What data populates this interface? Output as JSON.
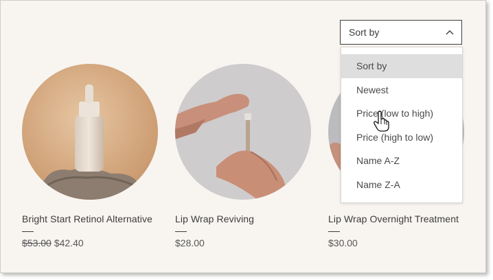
{
  "sort": {
    "label": "Sort by",
    "options": [
      {
        "label": "Sort by",
        "selected": true
      },
      {
        "label": "Newest",
        "selected": false
      },
      {
        "label": "Price (low to high)",
        "selected": false
      },
      {
        "label": "Price (high to low)",
        "selected": false
      },
      {
        "label": "Name A-Z",
        "selected": false
      },
      {
        "label": "Name Z-A",
        "selected": false
      }
    ]
  },
  "products": [
    {
      "name": "Bright Start Retinol Alternative",
      "old_price": "$53.00",
      "price": "$42.40"
    },
    {
      "name": "Lip Wrap Reviving",
      "old_price": "",
      "price": "$28.00"
    },
    {
      "name": "Lip Wrap Overnight Treatment",
      "old_price": "",
      "price": "$30.00"
    }
  ],
  "colors": {
    "background": "#f8f5f1",
    "selected_option": "#dedede",
    "text": "#3b3b3b"
  },
  "icons": {
    "sort_chevron": "chevron-up-icon",
    "cursor": "hand-pointer-cursor-icon"
  }
}
